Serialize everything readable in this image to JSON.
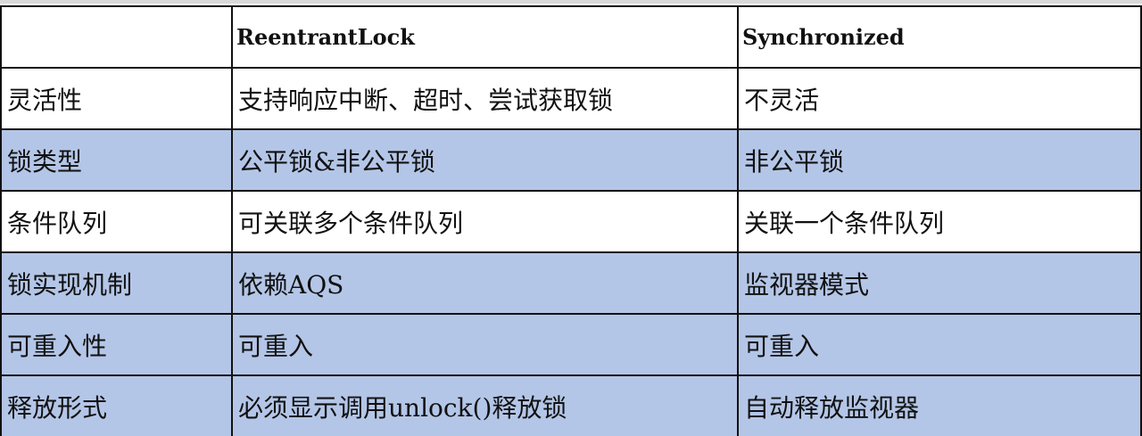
{
  "table": {
    "headers": [
      "",
      "ReentrantLock",
      "Synchronized"
    ],
    "rows": [
      {
        "feature": "灵活性",
        "reentrant_lock": "支持响应中断、超时、尝试获取锁",
        "synchronized": "不灵活"
      },
      {
        "feature": "锁类型",
        "reentrant_lock": "公平锁&非公平锁",
        "synchronized": "非公平锁"
      },
      {
        "feature": "条件队列",
        "reentrant_lock": "可关联多个条件队列",
        "synchronized": "关联一个条件队列"
      },
      {
        "feature": "锁实现机制",
        "reentrant_lock": "依赖AQS",
        "synchronized": "监视器模式"
      },
      {
        "feature": "可重入性",
        "reentrant_lock": "可重入",
        "synchronized": "可重入"
      },
      {
        "feature": "释放形式",
        "reentrant_lock": "必须显示调用unlock()释放锁",
        "synchronized": "自动释放监视器"
      }
    ]
  },
  "colors": {
    "shaded_row": "#b4c6e7",
    "plain_row": "#ffffff",
    "border": "#111111"
  }
}
